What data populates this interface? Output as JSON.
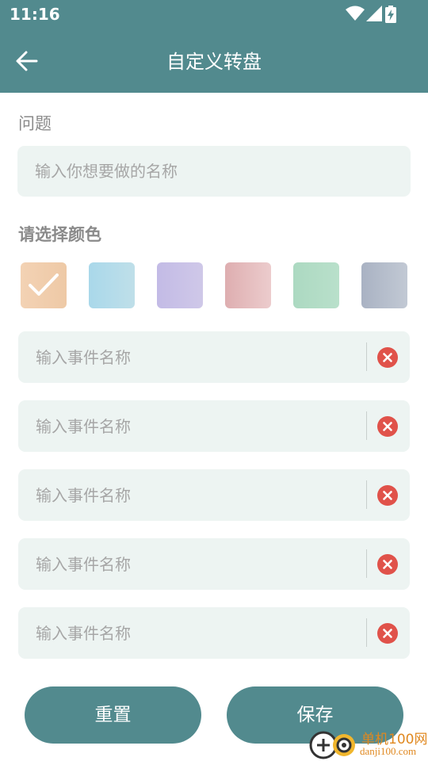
{
  "status_bar": {
    "time": "11:16"
  },
  "app_bar": {
    "title": "自定义转盘"
  },
  "question": {
    "label": "问题",
    "placeholder": "输入你想要做的名称",
    "value": ""
  },
  "colors": {
    "label": "请选择颜色",
    "selected_index": 0,
    "swatches": [
      {
        "name": "peach",
        "from": "#f3d2b4",
        "to": "#eec9a6"
      },
      {
        "name": "sky-blue",
        "from": "#a9d8ea",
        "to": "#bfdfe9"
      },
      {
        "name": "lavender",
        "from": "#c3bbe6",
        "to": "#cfc8e8"
      },
      {
        "name": "pink",
        "from": "#deaeb0",
        "to": "#eccccd"
      },
      {
        "name": "mint",
        "from": "#acd9c1",
        "to": "#b9e0cb"
      },
      {
        "name": "slate",
        "from": "#a9b2c3",
        "to": "#c2c9d4"
      }
    ]
  },
  "events": [
    {
      "placeholder": "输入事件名称",
      "value": ""
    },
    {
      "placeholder": "输入事件名称",
      "value": ""
    },
    {
      "placeholder": "输入事件名称",
      "value": ""
    },
    {
      "placeholder": "输入事件名称",
      "value": ""
    },
    {
      "placeholder": "输入事件名称",
      "value": ""
    }
  ],
  "actions": {
    "reset_label": "重置",
    "save_label": "保存"
  },
  "watermark": {
    "cn": "单机100网",
    "en": "danji100.com"
  },
  "theme": {
    "primary": "#528a8e",
    "field_bg": "#edf4f2",
    "delete": "#e0524a"
  }
}
